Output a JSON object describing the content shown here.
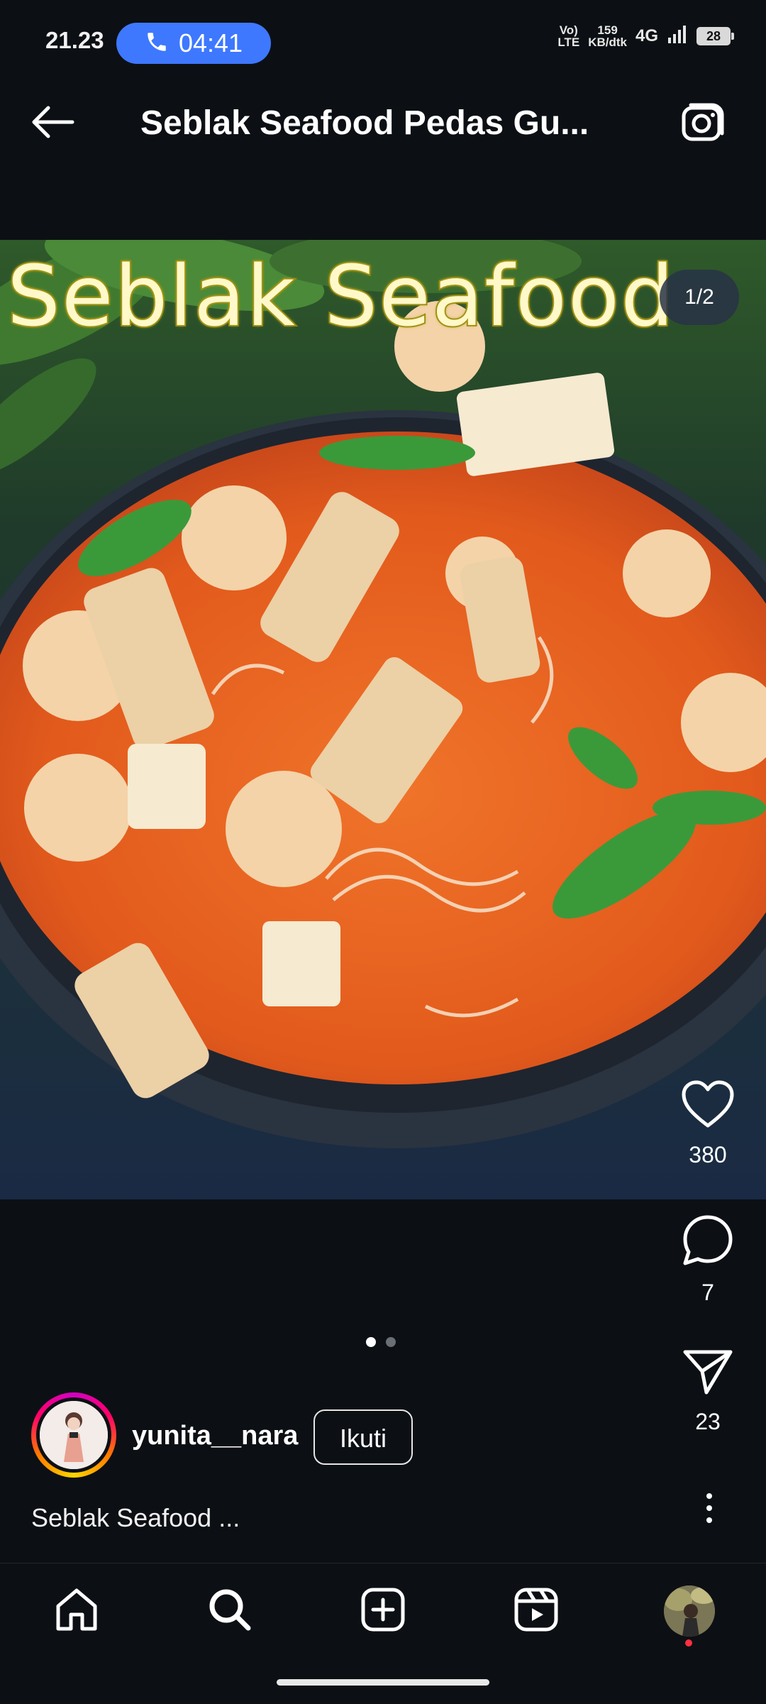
{
  "status_bar": {
    "time": "21.23",
    "call_timer": "04:41",
    "volte_top": "Vo)",
    "volte_bottom": "LTE",
    "speed_value": "159",
    "speed_unit": "KB/dtk",
    "network": "4G",
    "battery": "28"
  },
  "header": {
    "title": "Seblak Seafood Pedas Gu..."
  },
  "post": {
    "image_caption": "Seblak Seafood",
    "page_counter": "1/2",
    "carousel_total": 2,
    "carousel_active": 1
  },
  "actions": {
    "likes": "380",
    "comments": "7",
    "shares": "23"
  },
  "author": {
    "username": "yunita__nara",
    "follow_label": "Ikuti"
  },
  "caption": "Seblak Seafood ...",
  "bottom_nav": {
    "items": [
      "home-icon",
      "search-icon",
      "create-icon",
      "reels-icon",
      "profile-avatar"
    ]
  },
  "colors": {
    "background": "#0c1014",
    "call_pill": "#3e78ff",
    "notification_dot": "#ff3040"
  }
}
